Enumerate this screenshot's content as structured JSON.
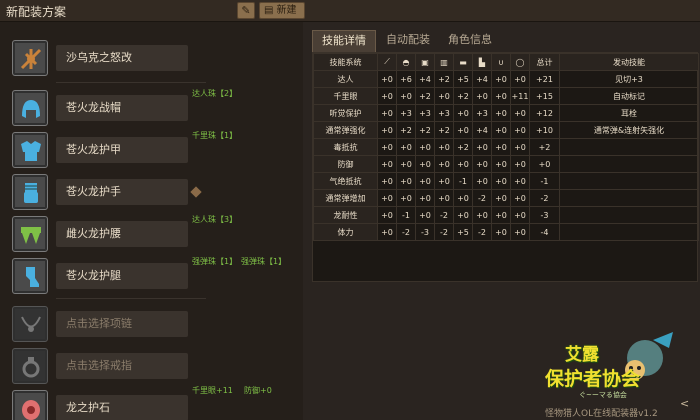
{
  "header": {
    "title": "新配装方案",
    "new_label": "新建"
  },
  "equipment": [
    {
      "name": "沙乌克之怒改",
      "decos": [],
      "icon": "weapon-icon",
      "color": "#c9823a"
    },
    {
      "name": "苍火龙战帽",
      "decos": [
        "达人珠【2】"
      ],
      "icon": "helmet-icon",
      "color": "#4ab0e0"
    },
    {
      "name": "苍火龙护甲",
      "decos": [
        "千里珠【1】"
      ],
      "icon": "chest-armor-icon",
      "color": "#4ab0e0"
    },
    {
      "name": "苍火龙护手",
      "decos": [],
      "icon": "gauntlet-icon",
      "color": "#4ab0e0"
    },
    {
      "name": "雌火龙护腰",
      "decos": [
        "达人珠【3】"
      ],
      "icon": "waist-armor-icon",
      "color": "#7fc046"
    },
    {
      "name": "苍火龙护腿",
      "decos": [
        "强弹珠【1】",
        "强弹珠【1】"
      ],
      "icon": "leg-armor-icon",
      "color": "#4ab0e0"
    },
    {
      "name": "点击选择项链",
      "decos": [],
      "icon": "necklace-icon",
      "color": "#777"
    },
    {
      "name": "点击选择戒指",
      "decos": [],
      "icon": "ring-icon",
      "color": "#777"
    },
    {
      "name": "龙之护石",
      "decos": [
        "千里眼+11",
        "防御+0"
      ],
      "icon": "talisman-icon",
      "color": "#e07070"
    }
  ],
  "tabs": [
    "技能详情",
    "自动配装",
    "角色信息"
  ],
  "table": {
    "headers": {
      "skill": "技能系统",
      "total": "总计",
      "active": "发动技能"
    },
    "col_icons": [
      "weapon",
      "helmet",
      "chest",
      "gauntlet",
      "waist",
      "legs",
      "necklace",
      "ring"
    ],
    "rows": [
      {
        "skill": "达人",
        "vals": [
          "+0",
          "+6",
          "+4",
          "+2",
          "+5",
          "+4",
          "+0",
          "+0"
        ],
        "total": "+21",
        "active": "见切+3"
      },
      {
        "skill": "千里眼",
        "vals": [
          "+0",
          "+0",
          "+2",
          "+0",
          "+2",
          "+0",
          "+0",
          "+11"
        ],
        "total": "+15",
        "active": "自动标记"
      },
      {
        "skill": "听觉保护",
        "vals": [
          "+0",
          "+3",
          "+3",
          "+3",
          "+0",
          "+3",
          "+0",
          "+0"
        ],
        "total": "+12",
        "active": "耳栓"
      },
      {
        "skill": "通常弹强化",
        "vals": [
          "+0",
          "+2",
          "+2",
          "+2",
          "+0",
          "+4",
          "+0",
          "+0"
        ],
        "total": "+10",
        "active": "通常弹&连射矢强化"
      },
      {
        "skill": "毒抵抗",
        "vals": [
          "+0",
          "+0",
          "+0",
          "+0",
          "+2",
          "+0",
          "+0",
          "+0"
        ],
        "total": "+2",
        "active": ""
      },
      {
        "skill": "防御",
        "vals": [
          "+0",
          "+0",
          "+0",
          "+0",
          "+0",
          "+0",
          "+0",
          "+0"
        ],
        "total": "+0",
        "active": ""
      },
      {
        "skill": "气绝抵抗",
        "vals": [
          "+0",
          "+0",
          "+0",
          "+0",
          "-1",
          "+0",
          "+0",
          "+0"
        ],
        "total": "-1",
        "active": ""
      },
      {
        "skill": "通常弹增加",
        "vals": [
          "+0",
          "+0",
          "+0",
          "+0",
          "+0",
          "-2",
          "+0",
          "+0"
        ],
        "total": "-2",
        "active": ""
      },
      {
        "skill": "龙耐性",
        "vals": [
          "+0",
          "-1",
          "+0",
          "-2",
          "+0",
          "+0",
          "+0",
          "+0"
        ],
        "total": "-3",
        "active": ""
      },
      {
        "skill": "体力",
        "vals": [
          "+0",
          "-2",
          "-3",
          "-2",
          "+5",
          "-2",
          "+0",
          "+0"
        ],
        "total": "-4",
        "active": ""
      }
    ]
  },
  "watermark": {
    "line1": "艾露",
    "line2": "保护者协会",
    "small": "ぐ~ーマる協会",
    "footer": "怪物猎人OL在线配装器v1.2"
  }
}
